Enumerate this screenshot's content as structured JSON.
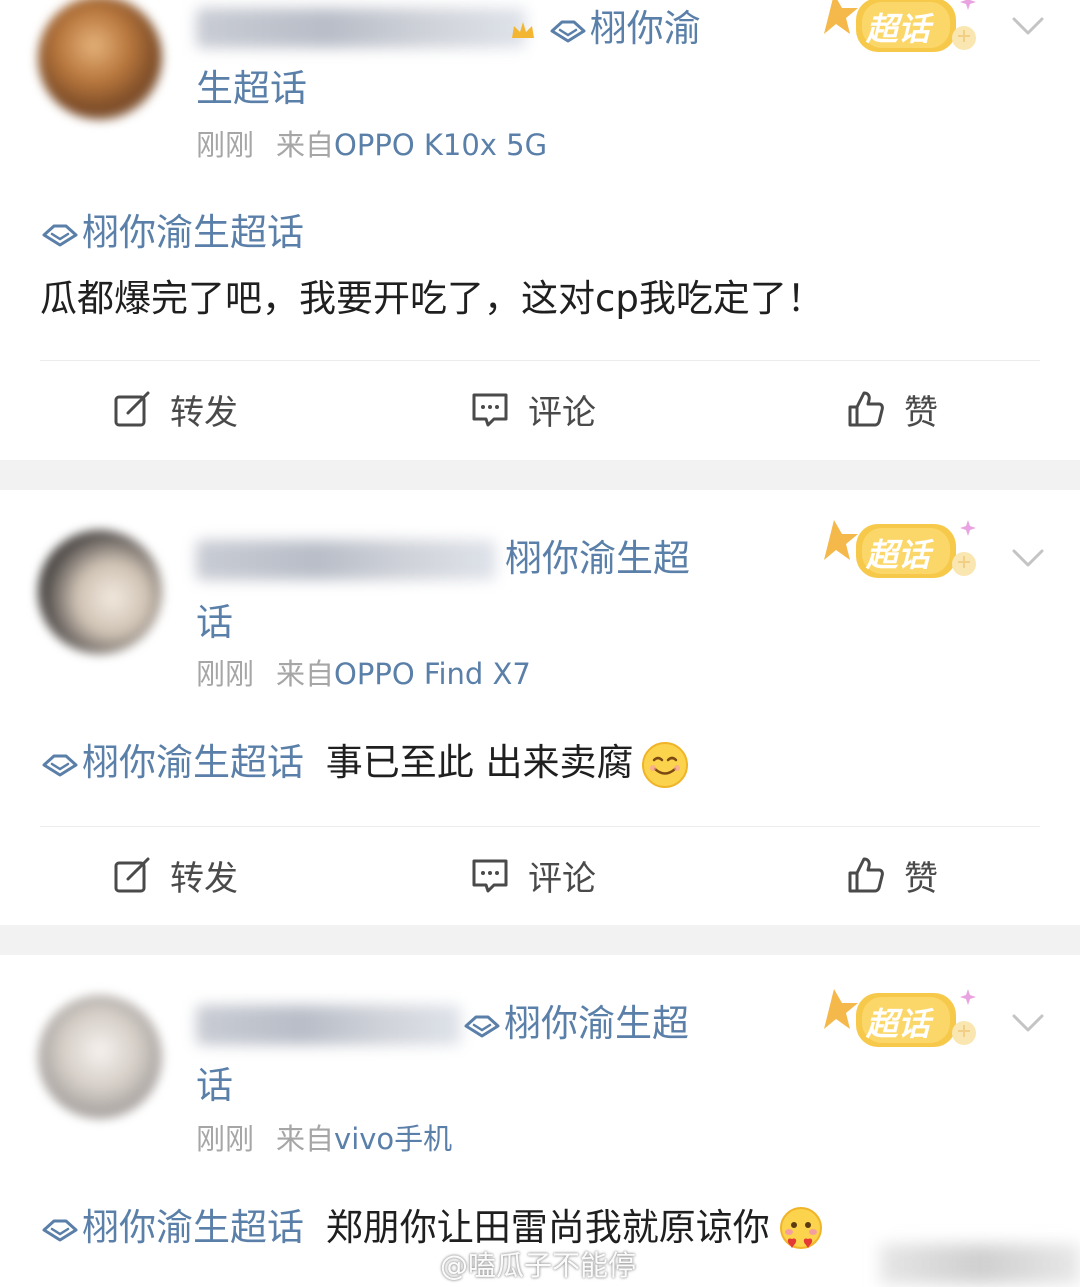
{
  "posts": [
    {
      "name_line1": "栩你渝",
      "name_line2": "生超话",
      "time": "刚刚",
      "from_prefix": "来自",
      "device": "OPPO K10x 5G",
      "topic": "栩你渝生超话",
      "text": "瓜都爆完了吧，我要开吃了，这对cp我吃定了！",
      "badge": "超话"
    },
    {
      "name_line1": "栩你渝生超",
      "name_line2": "话",
      "time": "刚刚",
      "from_prefix": "来自",
      "device": "OPPO Find X7",
      "topic": "栩你渝生超话",
      "text": "事已至此 出来卖腐",
      "badge": "超话"
    },
    {
      "name_line1": "栩你渝生超",
      "name_line2": "话",
      "time": "刚刚",
      "from_prefix": "来自",
      "device": "vivo手机",
      "topic": "栩你渝生超话",
      "text": "郑朋你让田雷尚我就原谅你",
      "badge": "超话"
    }
  ],
  "actions": {
    "repost": "转发",
    "comment": "评论",
    "like": "赞"
  },
  "watermark": "@嗑瓜子不能停",
  "colors": {
    "link_blue": "#5a7fa8",
    "meta_gray": "#a6a6a6",
    "separator": "#f2f2f2",
    "badge_yellow": "#f7c94b"
  }
}
